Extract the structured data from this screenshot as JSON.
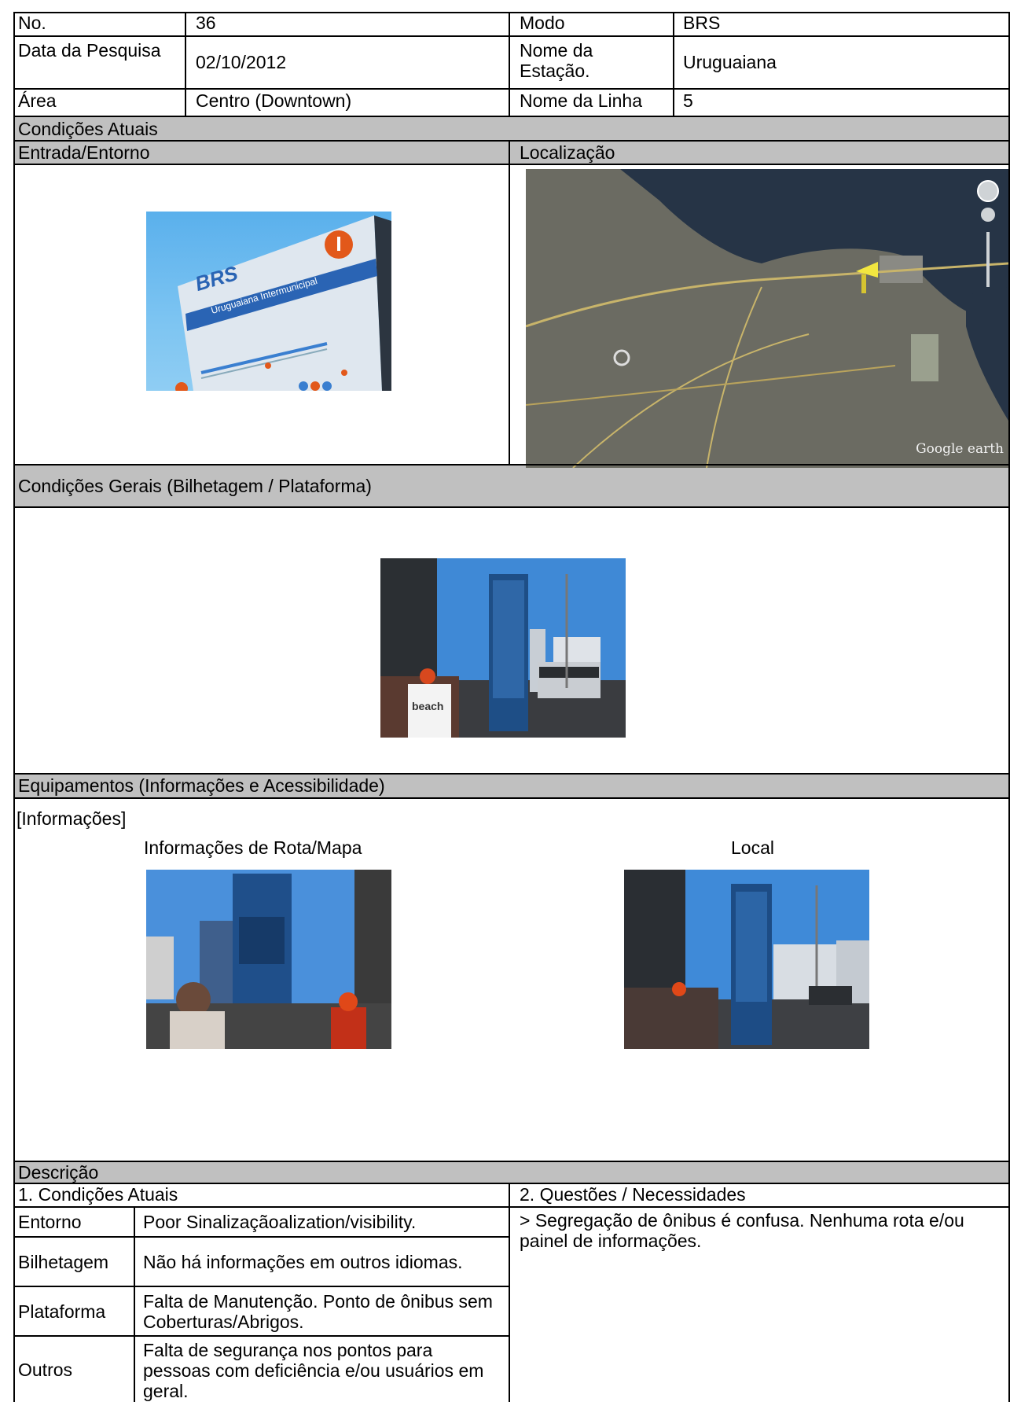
{
  "header": {
    "no_label": "No.",
    "no_value": "36",
    "modo_label": "Modo",
    "modo_value": "BRS",
    "data_label": "Data da Pesquisa",
    "data_value": "02/10/2012",
    "estacao_label": "Nome da Estação.",
    "estacao_value": "Uruguaiana",
    "area_label": "Área",
    "area_value": "Centro (Downtown)",
    "linha_label": "Nome da Linha",
    "linha_value": "5"
  },
  "sections": {
    "condicoes_atuais": "Condições Atuais",
    "entrada": "Entrada/Entorno",
    "localizacao": "Localização",
    "condicoes_gerais": "Condições Gerais (Bilhetagem / Plataforma)",
    "equipamentos": "Equipamentos (Informações e Acessibilidade)",
    "descricao": "Descrição"
  },
  "photos": {
    "sign_brand": "BRS",
    "sign_line": "Uruguaiana Intermunicipal",
    "map_watermark": "Google earth",
    "tshirt_text": "beach"
  },
  "equipamentos": {
    "tag": "[Informações]",
    "caption_left": "Informações de Rota/Mapa",
    "caption_right": "Local"
  },
  "descricao": {
    "col1_title": "1.   Condições Atuais",
    "col2_title": "2.   Questões / Necessidades",
    "rows": [
      {
        "label": "Entorno",
        "text": "Poor Sinalizaçãoalization/visibility."
      },
      {
        "label": "Bilhetagem",
        "text": "Não há informações em outros idiomas."
      },
      {
        "label": "Plataforma",
        "text": "Falta de Manutenção. Ponto de ônibus sem Coberturas/Abrigos."
      },
      {
        "label": "Outros",
        "text": "Falta de segurança nos pontos para pessoas com deficiência e/ou usuários em geral."
      }
    ],
    "issues": "> Segregação de ônibus é confusa. Nenhuma rota e/ou painel de informações."
  }
}
